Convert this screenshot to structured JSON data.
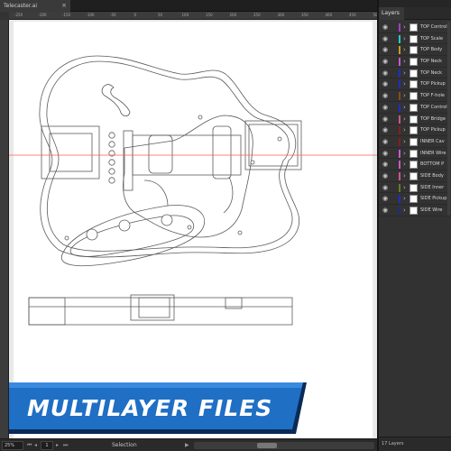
{
  "document": {
    "tab_title": "Telecaster.ai",
    "tab_close": "×"
  },
  "ruler": {
    "labels": [
      "-250",
      "-200",
      "-150",
      "-100",
      "-50",
      "0",
      "50",
      "100",
      "150",
      "200",
      "250",
      "300",
      "350",
      "400",
      "450",
      "500"
    ]
  },
  "banner": {
    "text": "MULTILAYER FILES",
    "color": "#1f6fc4",
    "shadow_color": "#0b2a55"
  },
  "statusbar": {
    "zoom": "25%",
    "page": "1",
    "tool": "Selection"
  },
  "panel": {
    "tab_label": "Layers",
    "layer_count": "17 Layers",
    "layers": [
      {
        "name": "TOP Control",
        "color": "#a040c8"
      },
      {
        "name": "TOP Scale",
        "color": "#2ec8c8"
      },
      {
        "name": "TOP Body",
        "color": "#c89a1e"
      },
      {
        "name": "TOP Neck",
        "color": "#c85ac8"
      },
      {
        "name": "TOP Neck",
        "color": "#1e2ec8"
      },
      {
        "name": "TOP Pickup",
        "color": "#1e2ec8"
      },
      {
        "name": "TOP F-hole",
        "color": "#8a4a1e"
      },
      {
        "name": "TOP Control",
        "color": "#1e2ec8"
      },
      {
        "name": "TOP Bridge",
        "color": "#c85a8a"
      },
      {
        "name": "TOP Pickup",
        "color": "#8a1e1e"
      },
      {
        "name": "INNER Cav",
        "color": "#8a1e1e"
      },
      {
        "name": "INNER Wire",
        "color": "#c85ac8"
      },
      {
        "name": "BOTTOM P",
        "color": "#c85ac8"
      },
      {
        "name": "SIDE Body",
        "color": "#c85a8a"
      },
      {
        "name": "SIDE Inner",
        "color": "#6a7a1e"
      },
      {
        "name": "SIDE Pickup",
        "color": "#1e2ec8"
      },
      {
        "name": "SIDE Wire",
        "color": "#1e2e8a"
      }
    ]
  },
  "colors": {
    "guide": "#ff5a5a",
    "drawing": "#555555"
  }
}
